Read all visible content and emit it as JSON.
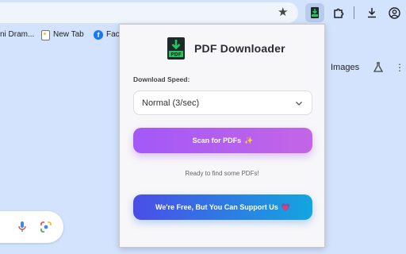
{
  "browser": {
    "bookmarks": [
      {
        "label": "ni Dram..."
      },
      {
        "label": "New Tab"
      },
      {
        "label": "Face"
      }
    ]
  },
  "page": {
    "images_link": "Images"
  },
  "popup": {
    "title": "PDF Downloader",
    "icon_text": "PDF",
    "speed_label": "Download Speed:",
    "speed_value": "Normal (3/sec)",
    "scan_button": "Scan for PDFs",
    "scan_emoji": "✨",
    "status": "Ready to find some PDFs!",
    "support_button": "We're Free, But You Can Support Us",
    "support_emoji": "💗"
  },
  "colors": {
    "chrome_bg": "#d3e3fd",
    "scan_gradient": [
      "#a259f7",
      "#c465e6"
    ],
    "support_gradient": [
      "#4a4ee6",
      "#13a6e0"
    ],
    "icon_green": "#22c55e"
  }
}
